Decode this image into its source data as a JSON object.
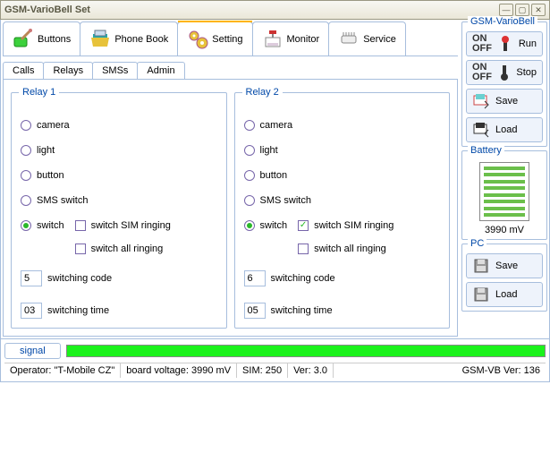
{
  "window": {
    "title": "GSM-VarioBell Set"
  },
  "toptabs": {
    "buttons": "Buttons",
    "phonebook": "Phone Book",
    "setting": "Setting",
    "monitor": "Monitor",
    "service": "Service"
  },
  "subtabs": {
    "calls": "Calls",
    "relays": "Relays",
    "smss": "SMSs",
    "admin": "Admin"
  },
  "relay1": {
    "legend": "Relay 1",
    "camera": "camera",
    "light": "light",
    "button": "button",
    "smsswitch": "SMS switch",
    "switch": "switch",
    "simringing": "switch SIM ringing",
    "allringing": "switch all ringing",
    "codeLabel": "switching code",
    "codeVal": "5",
    "timeLabel": "switching time",
    "timeVal": "03",
    "selected": "switch",
    "simChecked": false,
    "allChecked": false
  },
  "relay2": {
    "legend": "Relay 2",
    "camera": "camera",
    "light": "light",
    "button": "button",
    "smsswitch": "SMS switch",
    "switch": "switch",
    "simringing": "switch SIM ringing",
    "allringing": "switch all ringing",
    "codeLabel": "switching code",
    "codeVal": "6",
    "timeLabel": "switching time",
    "timeVal": "05",
    "selected": "switch",
    "simChecked": true,
    "allChecked": false
  },
  "right": {
    "gsm": {
      "legend": "GSM-VarioBell",
      "run": "Run",
      "stop": "Stop",
      "save": "Save",
      "load": "Load",
      "on": "ON",
      "off": "OFF"
    },
    "battery": {
      "legend": "Battery",
      "value": "3990 mV"
    },
    "pc": {
      "legend": "PC",
      "save": "Save",
      "load": "Load"
    }
  },
  "signal": {
    "label": "signal"
  },
  "status": {
    "operator": "Operator: \"T-Mobile CZ\"",
    "board": "board voltage: 3990 mV",
    "sim": "SIM: 250",
    "ver": "Ver: 3.0",
    "gsmvb": "GSM-VB Ver: 136"
  }
}
